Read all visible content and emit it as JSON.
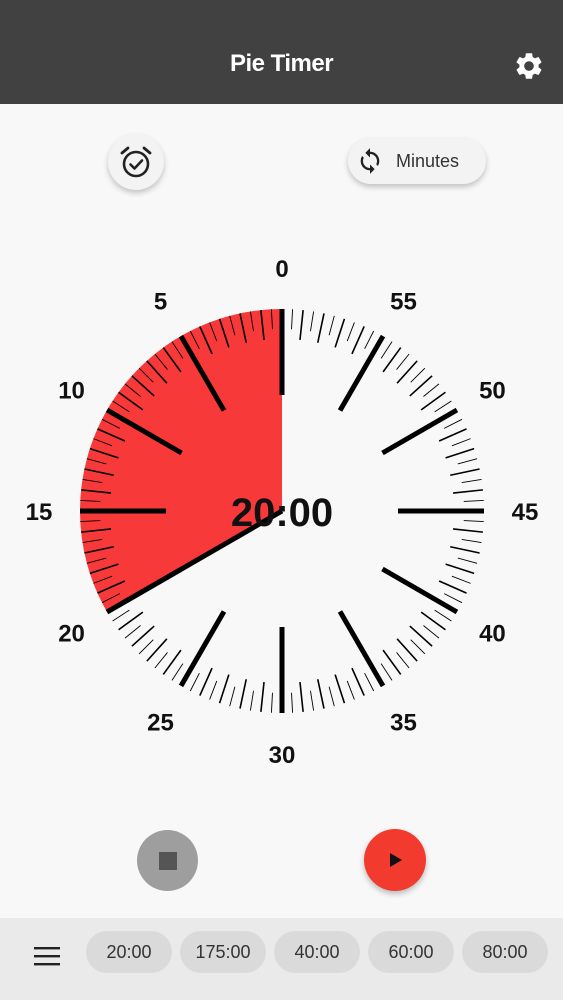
{
  "appbar": {
    "title": "Pie Timer",
    "settings_icon": "gear-icon"
  },
  "controls": {
    "alarm_icon": "alarm-check-icon",
    "unit_toggle_icon": "sync-icon",
    "unit_label": "Minutes"
  },
  "dial": {
    "labels": [
      "0",
      "5",
      "10",
      "15",
      "20",
      "25",
      "30",
      "35",
      "40",
      "45",
      "50",
      "55"
    ],
    "remaining_minutes": 20,
    "scale_minutes": 60,
    "time_display": "20:00",
    "colors": {
      "pie": "#f8393a",
      "ticks": "#000000"
    }
  },
  "playback": {
    "stop_icon": "stop-icon",
    "play_icon": "play-icon"
  },
  "bottombar": {
    "menu_icon": "hamburger-menu-icon",
    "presets": [
      "20:00",
      "175:00",
      "40:00",
      "60:00",
      "80:00"
    ]
  }
}
